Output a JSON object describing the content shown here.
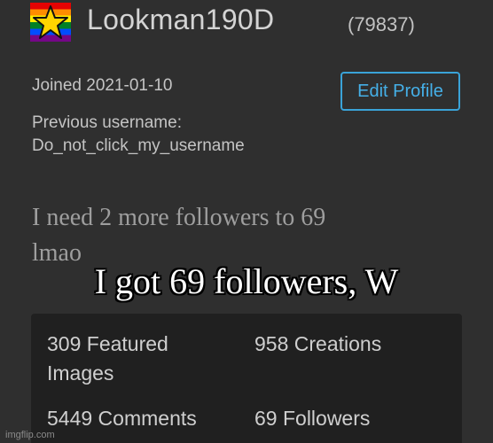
{
  "profile": {
    "username": "Lookman190D",
    "points": "(79837)",
    "joined": "Joined 2021-01-10",
    "edit_button": "Edit Profile",
    "previous_username_label": "Previous username:",
    "previous_username_value": "Do_not_click_my_username",
    "bio_line1": "I need 2 more followers to 69",
    "bio_line2": "lmao"
  },
  "stats": {
    "featured": "309 Featured Images",
    "creations": "958 Creations",
    "comments": "5449 Comments",
    "followers": "69 Followers"
  },
  "caption": "I got 69 followers, W",
  "watermark": "imgflip.com",
  "colors": {
    "background": "#2f2f2f",
    "stats_panel": "#202020",
    "accent": "#3aa3d8",
    "caption_text": "#ffffff"
  },
  "icons": {
    "avatar": "star-on-rainbow-avatar-icon"
  }
}
